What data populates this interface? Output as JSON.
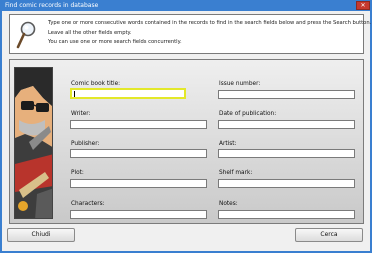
{
  "window": {
    "title": "Find comic records in database",
    "close_glyph": "✕"
  },
  "info": {
    "icon": "magnifier-icon",
    "lines": [
      "Type one or more consecutive words contained in the records to find in the search fields below and press the Search button.",
      "Leave all the other fields empty.",
      "You can use one or more search fields concurrently."
    ]
  },
  "form": {
    "comic_book_title": {
      "label": "Comic book title:",
      "value": ""
    },
    "issue_number": {
      "label": "Issue number:",
      "value": ""
    },
    "writer": {
      "label": "Writer:",
      "value": ""
    },
    "date_of_publication": {
      "label": "Date of publication:",
      "value": ""
    },
    "publisher": {
      "label": "Publisher:",
      "value": ""
    },
    "artist": {
      "label": "Artist:",
      "value": ""
    },
    "plot": {
      "label": "Plot:",
      "value": ""
    },
    "shelf_mark": {
      "label": "Shelf mark:",
      "value": ""
    },
    "characters": {
      "label": "Characters:",
      "value": ""
    },
    "notes": {
      "label": "Notes:",
      "value": ""
    }
  },
  "buttons": {
    "close": "Chiudi",
    "search": "Cerca"
  },
  "colors": {
    "titlebar": "#3a7fd0",
    "focus_border": "#e3e82a",
    "close_button": "#c6392f"
  }
}
